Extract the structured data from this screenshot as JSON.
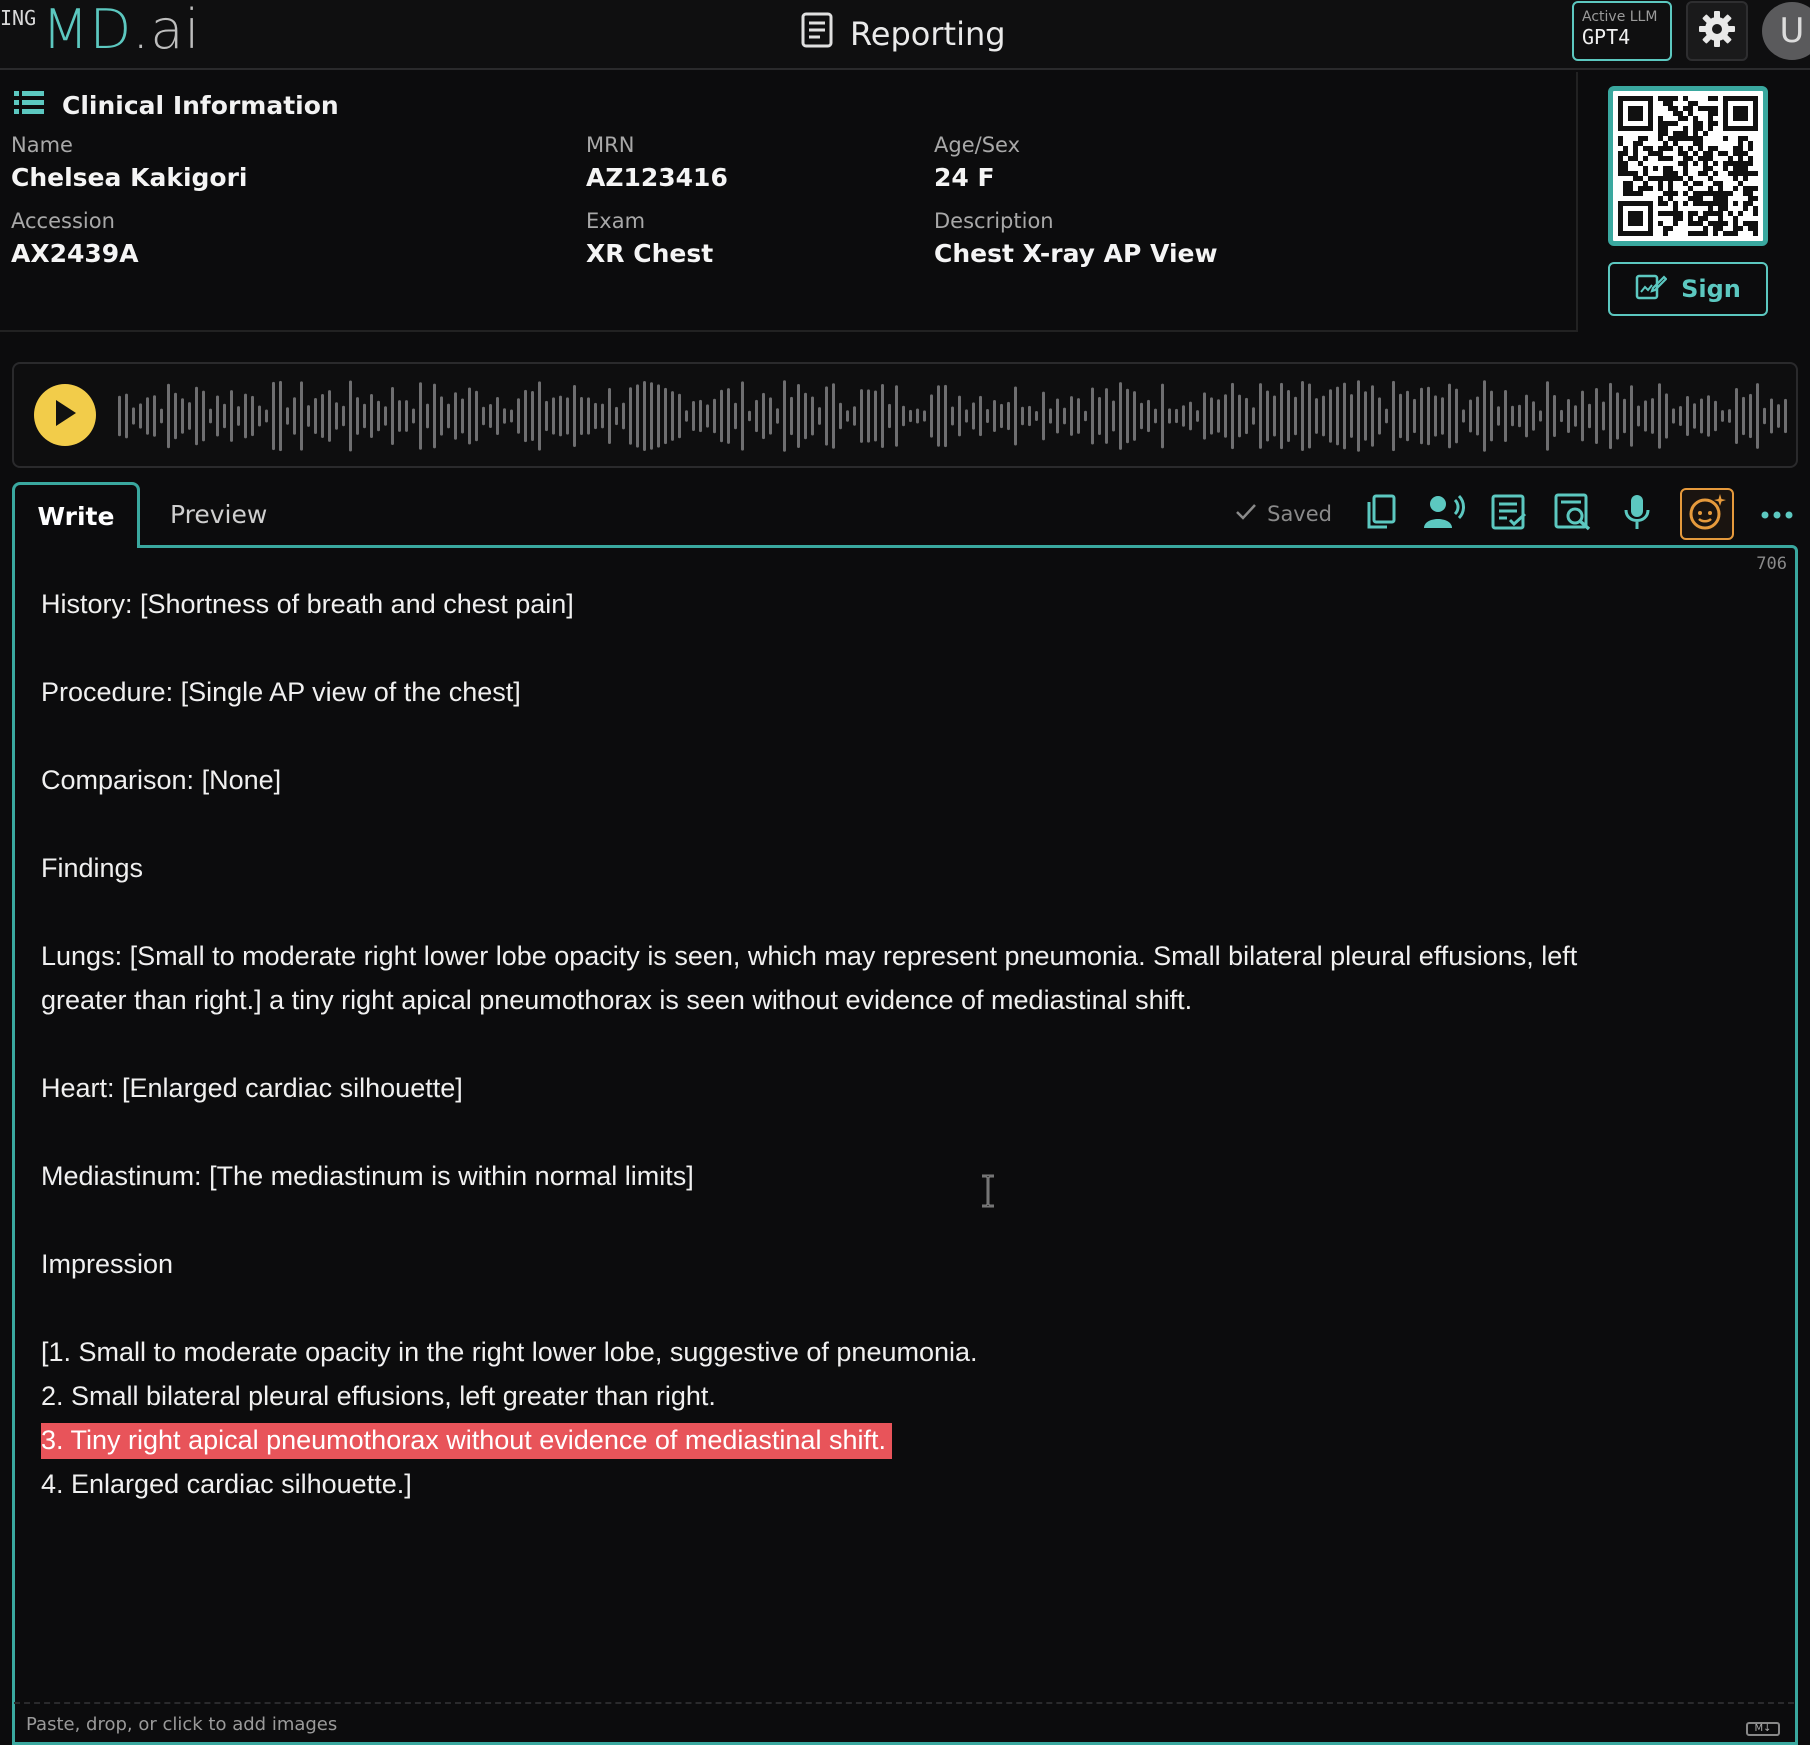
{
  "header": {
    "logo_prefix": "ING",
    "logo_main": "MD",
    "logo_suffix": ".ai",
    "title": "Reporting",
    "active_llm_label": "Active LLM",
    "active_llm_value": "GPT4",
    "avatar_initial": "U"
  },
  "clinical": {
    "heading": "Clinical Information",
    "fields": [
      {
        "label": "Name",
        "value": "Chelsea Kakigori"
      },
      {
        "label": "MRN",
        "value": "AZ123416"
      },
      {
        "label": "Age/Sex",
        "value": "24 F"
      },
      {
        "label": "Accession",
        "value": "AX2439A"
      },
      {
        "label": "Exam",
        "value": "XR Chest"
      },
      {
        "label": "Description",
        "value": "Chest X-ray AP View"
      }
    ],
    "sign_label": "Sign"
  },
  "editor": {
    "tabs": [
      {
        "label": "Write",
        "active": true
      },
      {
        "label": "Preview",
        "active": false
      }
    ],
    "saved_label": "Saved",
    "char_count": "706",
    "lines": {
      "history": "History: [Shortness of breath and chest pain]",
      "procedure": "Procedure: [Single AP view of the chest]",
      "comparison": "Comparison: [None]",
      "findings": "Findings",
      "lungs_1": "Lungs: [Small to moderate right lower lobe opacity is seen, which may represent pneumonia. Small bilateral pleural effusions, left",
      "lungs_2": "greater than right.] a tiny right apical pneumothorax is seen without evidence of mediastinal shift.",
      "heart": "Heart: [Enlarged cardiac silhouette]",
      "mediastinum": "Mediastinum: [The mediastinum is within normal limits]",
      "impression": "Impression",
      "imp_1": "[1. Small to moderate opacity in the right lower lobe, suggestive of pneumonia.",
      "imp_2": "2. Small bilateral pleural effusions, left greater than right.",
      "imp_3": "3. Tiny right apical pneumothorax without evidence of mediastinal shift.",
      "imp_4": "4. Enlarged cardiac silhouette.]"
    },
    "dropzone_text": "Paste, drop, or click to add images",
    "md_badge": "M↓"
  },
  "colors": {
    "accent": "#5cc8c0",
    "highlight": "#e8545a",
    "play": "#f2cc4a",
    "active_tool": "#e69a3c"
  },
  "icons": [
    "document-icon",
    "gear-icon",
    "list-icon",
    "qr-code-icon",
    "sign-icon",
    "play-icon",
    "check-icon",
    "copy-icon",
    "voice-user-icon",
    "checklist-icon",
    "search-document-icon",
    "microphone-icon",
    "ai-assistant-icon",
    "more-icon",
    "text-cursor-icon"
  ]
}
